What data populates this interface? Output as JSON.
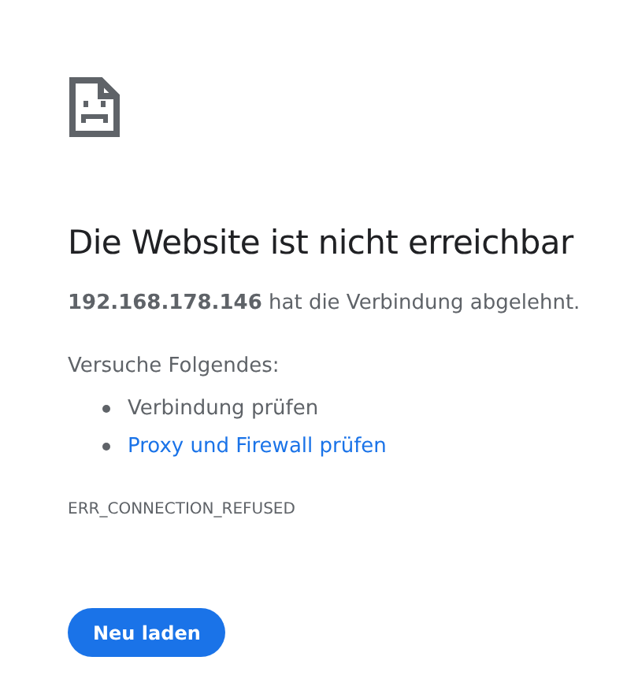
{
  "heading": "Die Website ist nicht erreichbar",
  "message": "**192.168.178.146** hat die Verbindung abgelehnt.",
  "suggestions_intro": "Versuche Folgendes:",
  "suggestions": [
    {
      "kind": "text",
      "label": "Verbindung prüfen"
    },
    {
      "kind": "link",
      "label": "Proxy und Firewall prüfen"
    }
  ],
  "error_code": "ERR_CONNECTION_REFUSED",
  "button": "Neu laden"
}
